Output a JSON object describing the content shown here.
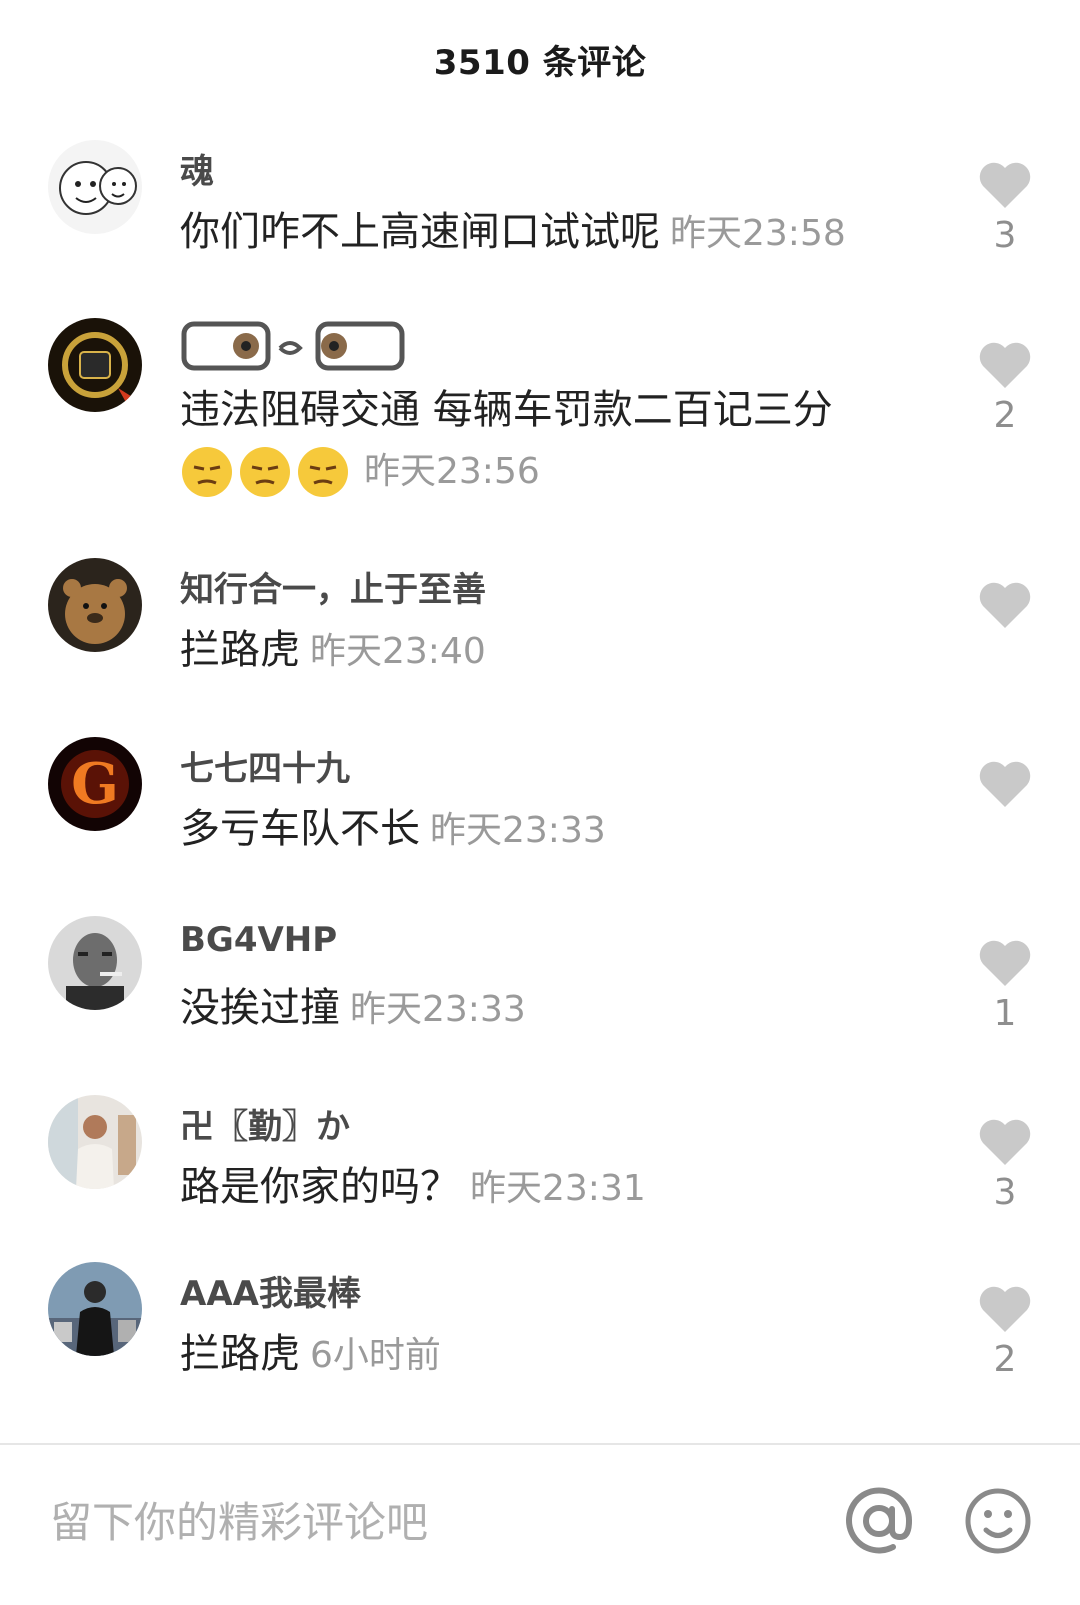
{
  "header": {
    "title": "3510 条评论"
  },
  "comments": [
    {
      "user": "魂",
      "text": "你们咋不上高速闸口试试呢",
      "time": "昨天23:58",
      "likes": "3"
    },
    {
      "user": "",
      "text": "违法阻碍交通 每辆车罚款二百记三分",
      "time": "昨天23:56",
      "likes": "2"
    },
    {
      "user": "知行合一，止于至善",
      "text": "拦路虎",
      "time": "昨天23:40",
      "likes": ""
    },
    {
      "user": "七七四十九",
      "text": "多亏车队不长",
      "time": "昨天23:33",
      "likes": ""
    },
    {
      "user": "BG4VHP",
      "text": "没挨过撞",
      "time": "昨天23:33",
      "likes": "1"
    },
    {
      "user": "卍〖勤〗か",
      "text": "路是你家的吗？",
      "time": "昨天23:31",
      "likes": "3"
    },
    {
      "user": "AAA我最棒",
      "text": "拦路虎",
      "time": "6小时前",
      "likes": "2"
    }
  ],
  "footer": {
    "placeholder": "留下你的精彩评论吧"
  },
  "icons": {
    "like": "heart-icon",
    "at": "at-icon",
    "emoji": "smiley-icon"
  },
  "colors": {
    "like_gray": "#c9c9c9",
    "time_gray": "#9a9a9a"
  }
}
